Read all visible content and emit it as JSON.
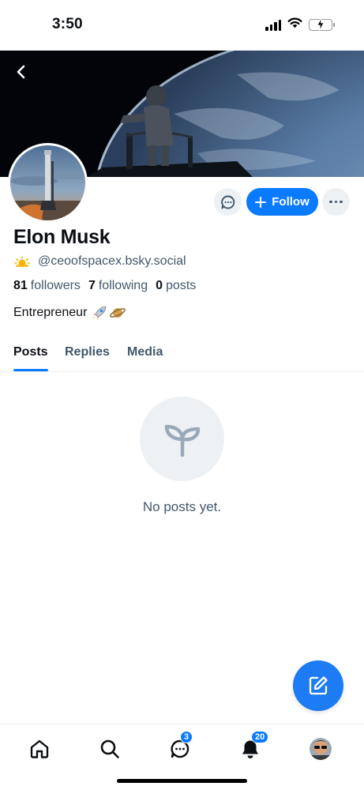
{
  "status_bar": {
    "time": "3:50"
  },
  "profile": {
    "display_name": "Elon Musk",
    "handle": "@ceoofspacex.bsky.social",
    "handle_emoji": "sun-behind-cloud",
    "followers_count": "81",
    "followers_label": "followers",
    "following_count": "7",
    "following_label": "following",
    "posts_count": "0",
    "posts_label": "posts",
    "bio": "Entrepreneur",
    "bio_emojis": [
      "rocket",
      "ringed-planet"
    ]
  },
  "actions": {
    "follow_label": "Follow"
  },
  "tabs": [
    {
      "label": "Posts",
      "active": true
    },
    {
      "label": "Replies",
      "active": false
    },
    {
      "label": "Media",
      "active": false
    }
  ],
  "empty_state": {
    "text": "No posts yet.",
    "icon": "sprout-icon"
  },
  "bottom_nav": {
    "items": [
      "home-icon",
      "search-icon",
      "chat-icon",
      "bell-icon",
      "profile-avatar"
    ],
    "chat_badge": "3",
    "notifications_badge": "20"
  },
  "colors": {
    "accent": "#0a7aff",
    "muted_text": "#42576c",
    "fab": "#1d7bf4"
  }
}
